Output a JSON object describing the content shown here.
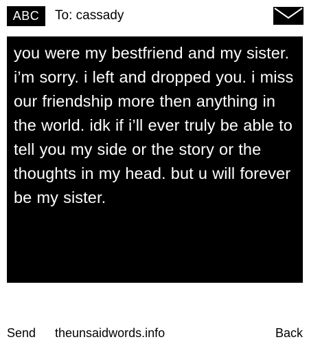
{
  "header": {
    "mode_label": "ABC",
    "recipient": "To: cassady",
    "envelope_icon": "envelope-icon"
  },
  "message": {
    "text": "you were my bestfriend and my sister. i’m sorry. i left and dropped you. i miss our friendship more then anything in the world. idk if i’ll ever truly be able to tell you my side or the story or the thoughts in my head. but u will forever be my sister."
  },
  "footer": {
    "send_label": "Send",
    "site": "theunsaidwords.info",
    "back_label": "Back"
  },
  "colors": {
    "background": "#ffffff",
    "message_bg": "#000000",
    "message_text": "#ffffff",
    "badge_bg": "#000000"
  }
}
